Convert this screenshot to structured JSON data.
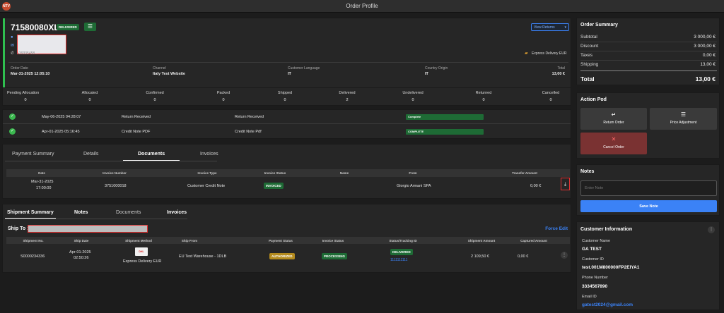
{
  "app": {
    "logo_text": "NTV",
    "window_title": "Order Profile"
  },
  "order": {
    "number": "71580080XL4",
    "status_badge": "DELIVERED",
    "view_returns_label": "View Returns",
    "phone_partial": "+39335458...",
    "shipping_method": "Express Delivery EUR",
    "info_labels": [
      "Order Date",
      "Channel",
      "Customer Language",
      "Country Origin",
      "Total"
    ],
    "info_values": [
      "Mar-31-2025 12:05:10",
      "Italy Test Website",
      "IT",
      "IT",
      "13,00 €"
    ]
  },
  "status_counts": {
    "labels": [
      "Pending Allocation",
      "Allocated",
      "Confirmed",
      "Packed",
      "Shipped",
      "Delivered",
      "Undelivered",
      "Returned",
      "Cancelled"
    ],
    "values": [
      "0",
      "0",
      "0",
      "0",
      "0",
      "2",
      "0",
      "0",
      "0"
    ]
  },
  "timeline": [
    {
      "date": "May-06-2025 04:28:07",
      "event": "Return Received",
      "description": "Return Received",
      "status": "Complete"
    },
    {
      "date": "Apr-01-2025 05:16:45",
      "event": "Credit Note PDF",
      "description": "Credit Note Pdf",
      "status": "COMPLETE"
    }
  ],
  "doc_tabs": [
    "Payment Summary",
    "Details",
    "Documents",
    "Invoices"
  ],
  "doc_table": {
    "headers": [
      "Date",
      "Invoice Number",
      "Invoice Type",
      "Invoice Status",
      "Name",
      "From",
      "Transfer Amount"
    ],
    "row": {
      "date_line1": "Mar-31-2025",
      "date_line2": "17:00:00",
      "invoice_number": "3751000018",
      "invoice_type": "Customer Credit Note",
      "status": "INVOICED",
      "name": "",
      "from": "Giorgio Armani SPA",
      "amount": "0,00 €"
    }
  },
  "ship_tabs": [
    "Shipment Summary",
    "Notes",
    "Documents",
    "Invoices"
  ],
  "ship_to_label": "Ship To :",
  "force_edit_label": "Force Edit",
  "ship_table": {
    "headers": [
      "Shipment No.",
      "Ship Date",
      "Shipment Method",
      "Ship From",
      "Payment Status",
      "Invoice Status",
      "Status/Tracking ID",
      "Shipment Amount",
      "Captured Amount"
    ],
    "row": {
      "shipment_no": "S0000234336",
      "date_line1": "Apr-01-2025",
      "date_line2": "02:50:26",
      "carrier_logo": "DHL",
      "method": "Express Delivery EUR",
      "ship_from": "EU Test Warehouse - 1DLB",
      "payment_status": "AUTHORIZED",
      "invoice_status": "PROCESSING",
      "status": "DELIVERED",
      "tracking": "1111111111",
      "shipment_amount": "2 109,50 €",
      "captured_amount": "0,00 €"
    }
  },
  "summary": {
    "title": "Order Summary",
    "rows": [
      {
        "label": "Subtotal",
        "value": "3 000,00 €"
      },
      {
        "label": "Discount",
        "value": "3 000,00 €"
      },
      {
        "label": "Taxes",
        "value": "0,00 €"
      },
      {
        "label": "Shipping",
        "value": "13,00 €"
      }
    ],
    "total_label": "Total",
    "total_value": "13,00 €"
  },
  "action_pod": {
    "title": "Action Pod",
    "return_order": "Return Order",
    "price_adjustment": "Price Adjustment",
    "cancel_order": "Cancel Order"
  },
  "notes": {
    "title": "Notes",
    "placeholder": "Enter Note",
    "save_label": "Save Note"
  },
  "customer": {
    "title": "Customer Information",
    "name_label": "Customer Name",
    "name": "GA TEST",
    "id_label": "Customer ID",
    "id": "test.001M800000FP2EIYA1",
    "phone_label": "Phone Number",
    "phone": "3334567890",
    "email_label": "Email ID",
    "email": "gatest2024@gmail.com"
  },
  "colors": {
    "accent_blue": "#3b82f6",
    "success_green": "#1e6b35",
    "left_bar_green": "#2fbf4f",
    "cancel_red": "#7a3232",
    "authorized_gold": "#b38a1d"
  }
}
